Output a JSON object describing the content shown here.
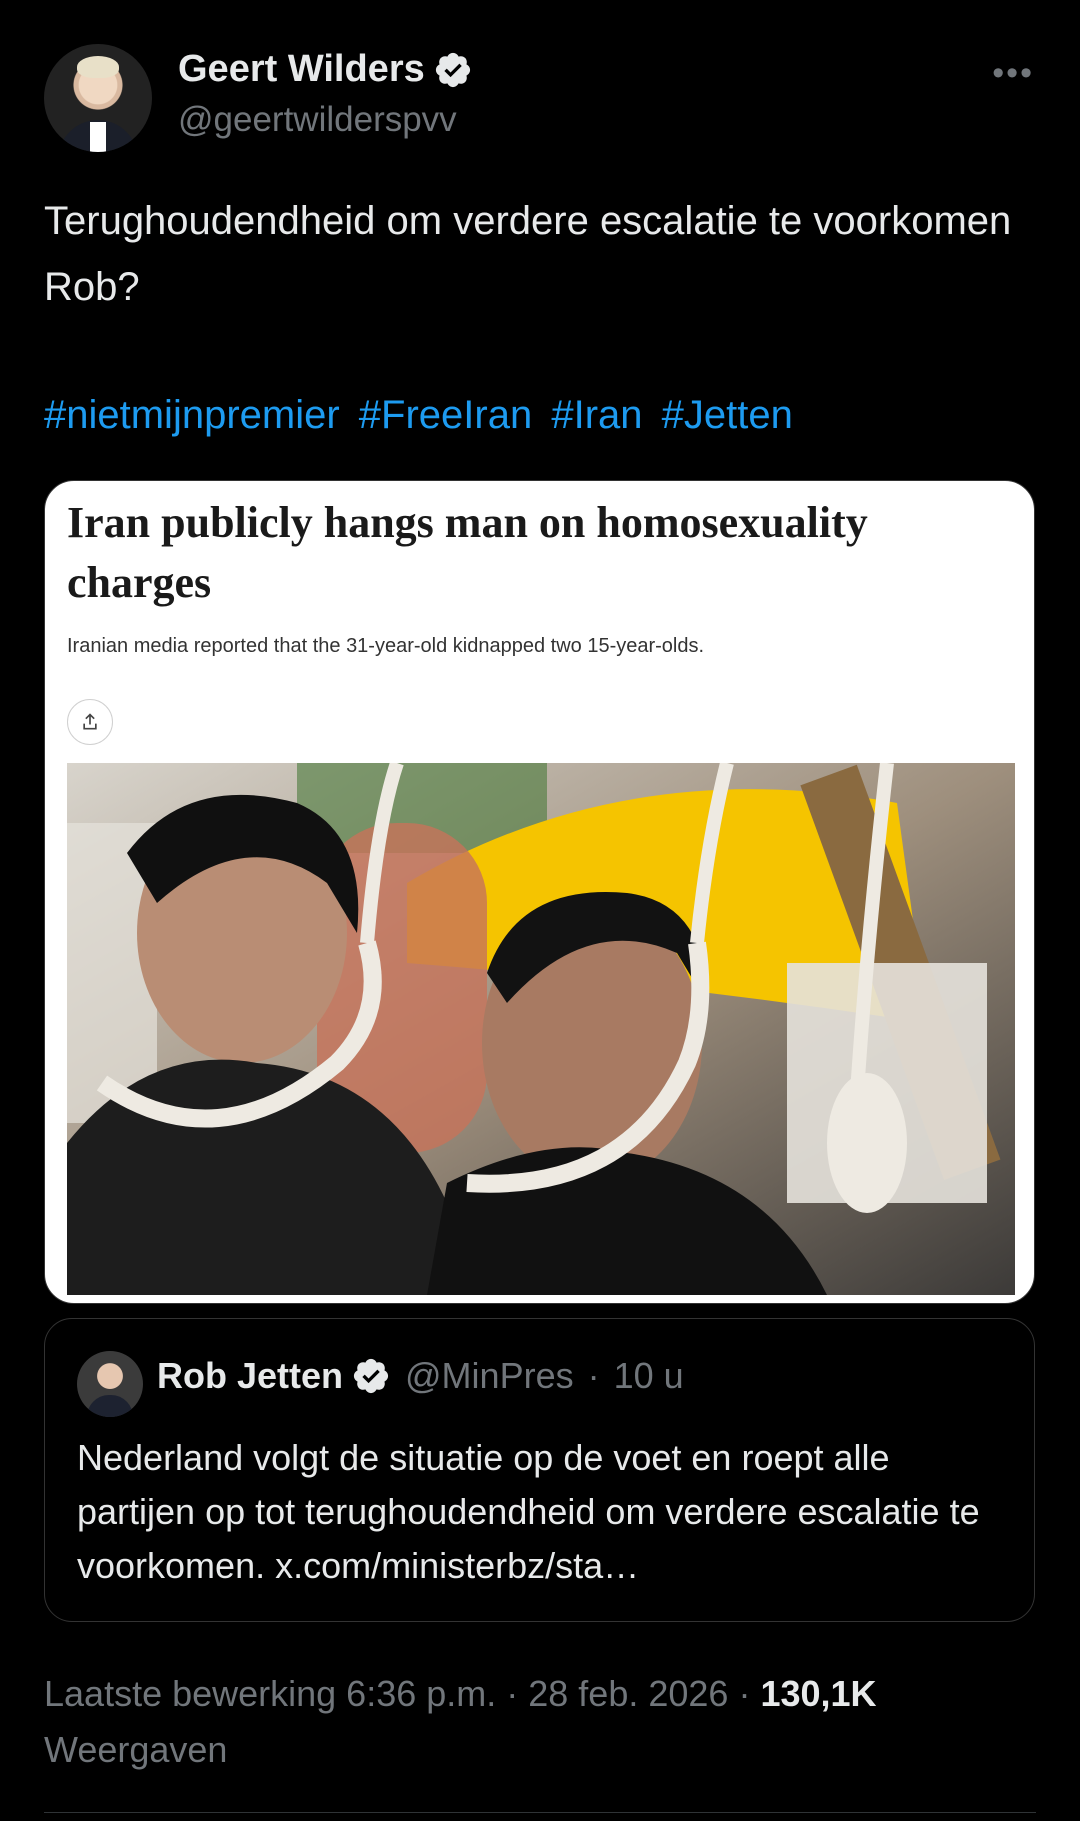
{
  "author": {
    "name": "Geert Wilders",
    "handle": "@geertwilderspvv",
    "avatar_icon": "profile-photo",
    "verified_icon": "verified-badge-icon"
  },
  "more_label": "•••",
  "tweet": {
    "text": "Terughoudendheid om verdere escalatie te voorkomen Rob?",
    "hashtags": [
      "#nietmijnpremier",
      "#FreeIran",
      "#Iran",
      "#Jetten"
    ]
  },
  "article": {
    "title": "Iran publicly hangs man on homosexuality charges",
    "subtitle": "Iranian media reported that the 31-year-old kidnapped two 15-year-olds.",
    "share_icon": "share-icon"
  },
  "quote": {
    "name": "Rob Jetten",
    "handle": "@MinPres",
    "separator": "·",
    "time": "10 u",
    "text": "Nederland volgt de situatie op de voet en roept alle partijen op tot terughoudendheid om verdere escalatie te voorkomen. x.com/ministerbz/sta…"
  },
  "meta": {
    "prefix": "Laatste bewerking 6:36 p.m. · 28 feb. 2026 · ",
    "views_count": "130,1K",
    "views_label": "Weergaven"
  },
  "colors": {
    "background": "#000000",
    "text": "#e7e9ea",
    "secondary": "#71767b",
    "link": "#1d9bf0",
    "verified": "#e7e9ea"
  }
}
